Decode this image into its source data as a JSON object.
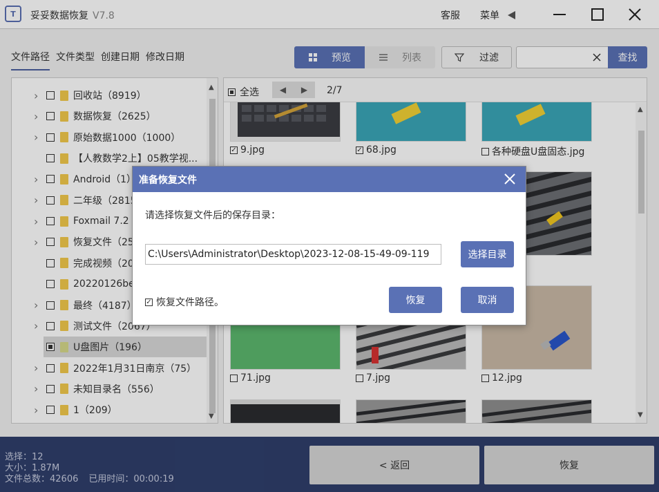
{
  "app": {
    "title": "妥妥数据恢复",
    "version": "V7.8",
    "logo_text": "T"
  },
  "titlebar": {
    "service": "客服",
    "menu": "菜单"
  },
  "tabs": [
    "文件路径",
    "文件类型",
    "创建日期",
    "修改日期"
  ],
  "view": {
    "preview": "预览",
    "list": "列表"
  },
  "filter": {
    "label": "过滤"
  },
  "search": {
    "value": "",
    "button": "查找"
  },
  "tree": {
    "items": [
      {
        "label": "回收站（8919）",
        "expandable": true,
        "checked": "none"
      },
      {
        "label": "数据恢复（2625）",
        "expandable": true,
        "checked": "none"
      },
      {
        "label": "原始数据1000（1000）",
        "expandable": true,
        "checked": "none"
      },
      {
        "label": "【人教数学2上】05教学视...",
        "expandable": false,
        "checked": "none"
      },
      {
        "label": "Android（1）",
        "expandable": true,
        "checked": "none"
      },
      {
        "label": "二年级（2815",
        "expandable": true,
        "checked": "none"
      },
      {
        "label": "Foxmail 7.2",
        "expandable": true,
        "checked": "none"
      },
      {
        "label": "恢复文件（25",
        "expandable": true,
        "checked": "none"
      },
      {
        "label": "完成视频（20",
        "expandable": false,
        "checked": "none"
      },
      {
        "label": "20220126be",
        "expandable": false,
        "checked": "none"
      },
      {
        "label": "最终（4187）",
        "expandable": true,
        "checked": "none"
      },
      {
        "label": "测试文件（2067）",
        "expandable": true,
        "checked": "none"
      },
      {
        "label": "U盘图片（196）",
        "expandable": false,
        "checked": "partial",
        "selected": true
      },
      {
        "label": "2022年1月31日南京（75）",
        "expandable": true,
        "checked": "none"
      },
      {
        "label": "未知目录名（556）",
        "expandable": true,
        "checked": "none"
      },
      {
        "label": "1（209）",
        "expandable": true,
        "checked": "none"
      }
    ]
  },
  "grid": {
    "select_all": "全选",
    "page": "2/7",
    "files": [
      {
        "name": "9.jpg",
        "checked": true,
        "scene": "keyboard"
      },
      {
        "name": "68.jpg",
        "checked": true,
        "scene": "teal"
      },
      {
        "name": "各种硬盘U盘固态.jpg",
        "checked": false,
        "scene": "teal"
      },
      {
        "name": "71.jpg",
        "checked": false,
        "scene": "green"
      },
      {
        "name": "7.jpg",
        "checked": false,
        "scene": "laptop"
      },
      {
        "name": "12.jpg",
        "checked": false,
        "scene": "beige"
      }
    ]
  },
  "status": {
    "selected": "选择：12",
    "size": "大小：1.87M",
    "total": "文件总数：42606",
    "elapsed": "已用时间：00:00:19"
  },
  "bottom": {
    "back": "< 返回",
    "recover": "恢复"
  },
  "dialog": {
    "title": "准备恢复文件",
    "prompt": "请选择恢复文件后的保存目录：",
    "path": "C:\\Users\\Administrator\\Desktop\\2023-12-08-15-49-09-119",
    "choose_dir": "选择目录",
    "keep_path_label": "恢复文件路径。",
    "keep_path_checked": true,
    "ok": "恢复",
    "cancel": "取消"
  },
  "colors": {
    "accent": "#5a71b5",
    "bottom_bar": "#2f3f6c"
  }
}
